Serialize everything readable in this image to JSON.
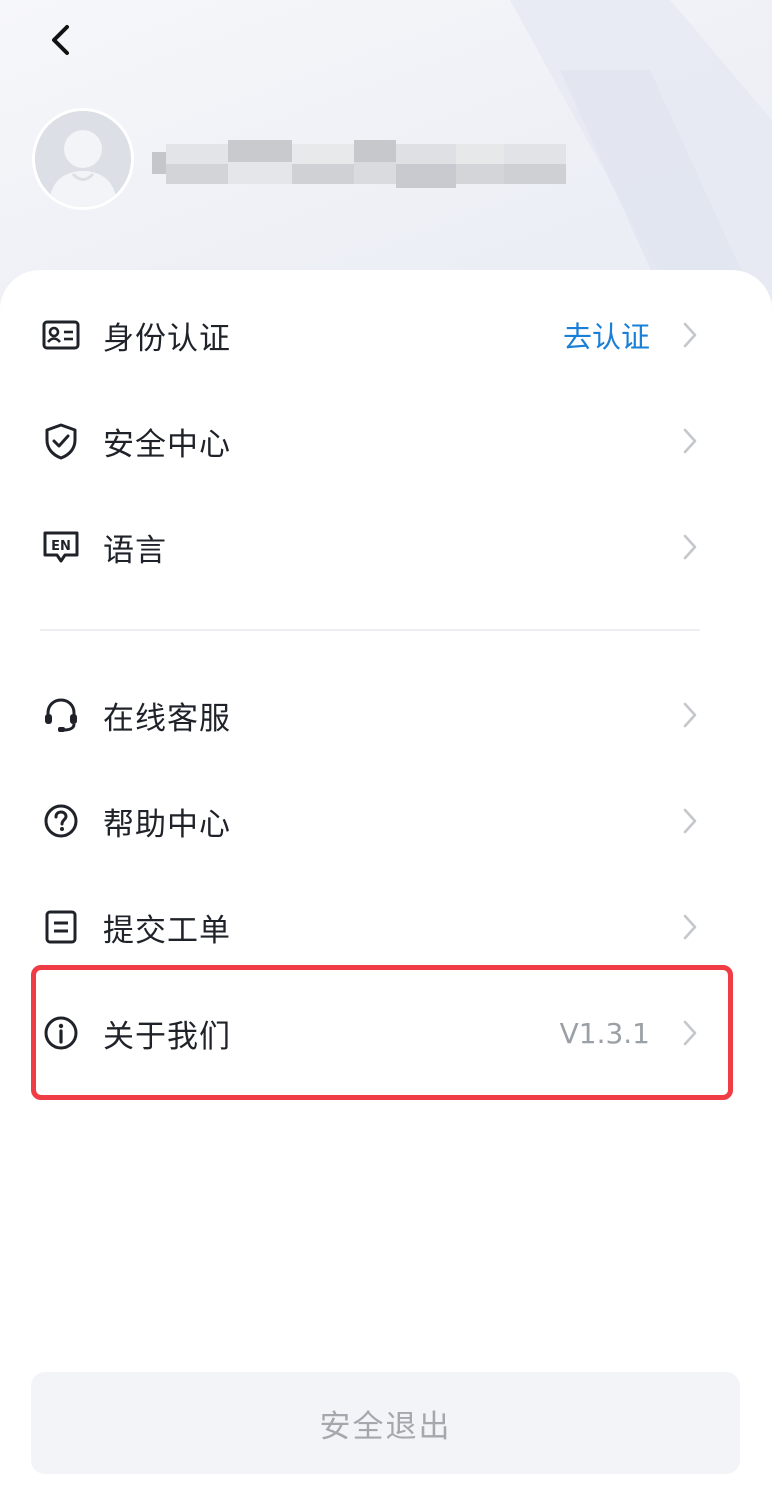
{
  "header": {
    "back_icon": "chevron-left-icon",
    "avatar_icon": "default-user-avatar",
    "username_masked": true
  },
  "menu_group_1": [
    {
      "label": "身份认证",
      "icon": "id-card-icon",
      "extra": "去认证"
    },
    {
      "label": "安全中心",
      "icon": "shield-check-icon",
      "extra": ""
    },
    {
      "label": "语言",
      "icon": "language-en-icon",
      "extra": ""
    }
  ],
  "menu_group_2": [
    {
      "label": "在线客服",
      "icon": "headset-icon",
      "extra": ""
    },
    {
      "label": "帮助中心",
      "icon": "help-circle-icon",
      "extra": ""
    },
    {
      "label": "提交工单",
      "icon": "ticket-form-icon",
      "extra": ""
    },
    {
      "label": "关于我们",
      "icon": "info-circle-icon",
      "extra": "V1.3.1"
    }
  ],
  "logout": {
    "label": "安全退出"
  },
  "colors": {
    "link": "#1a7fd6",
    "highlight_border": "#f03c44",
    "text_primary": "#1f2329",
    "text_secondary": "#9aa0a6"
  }
}
